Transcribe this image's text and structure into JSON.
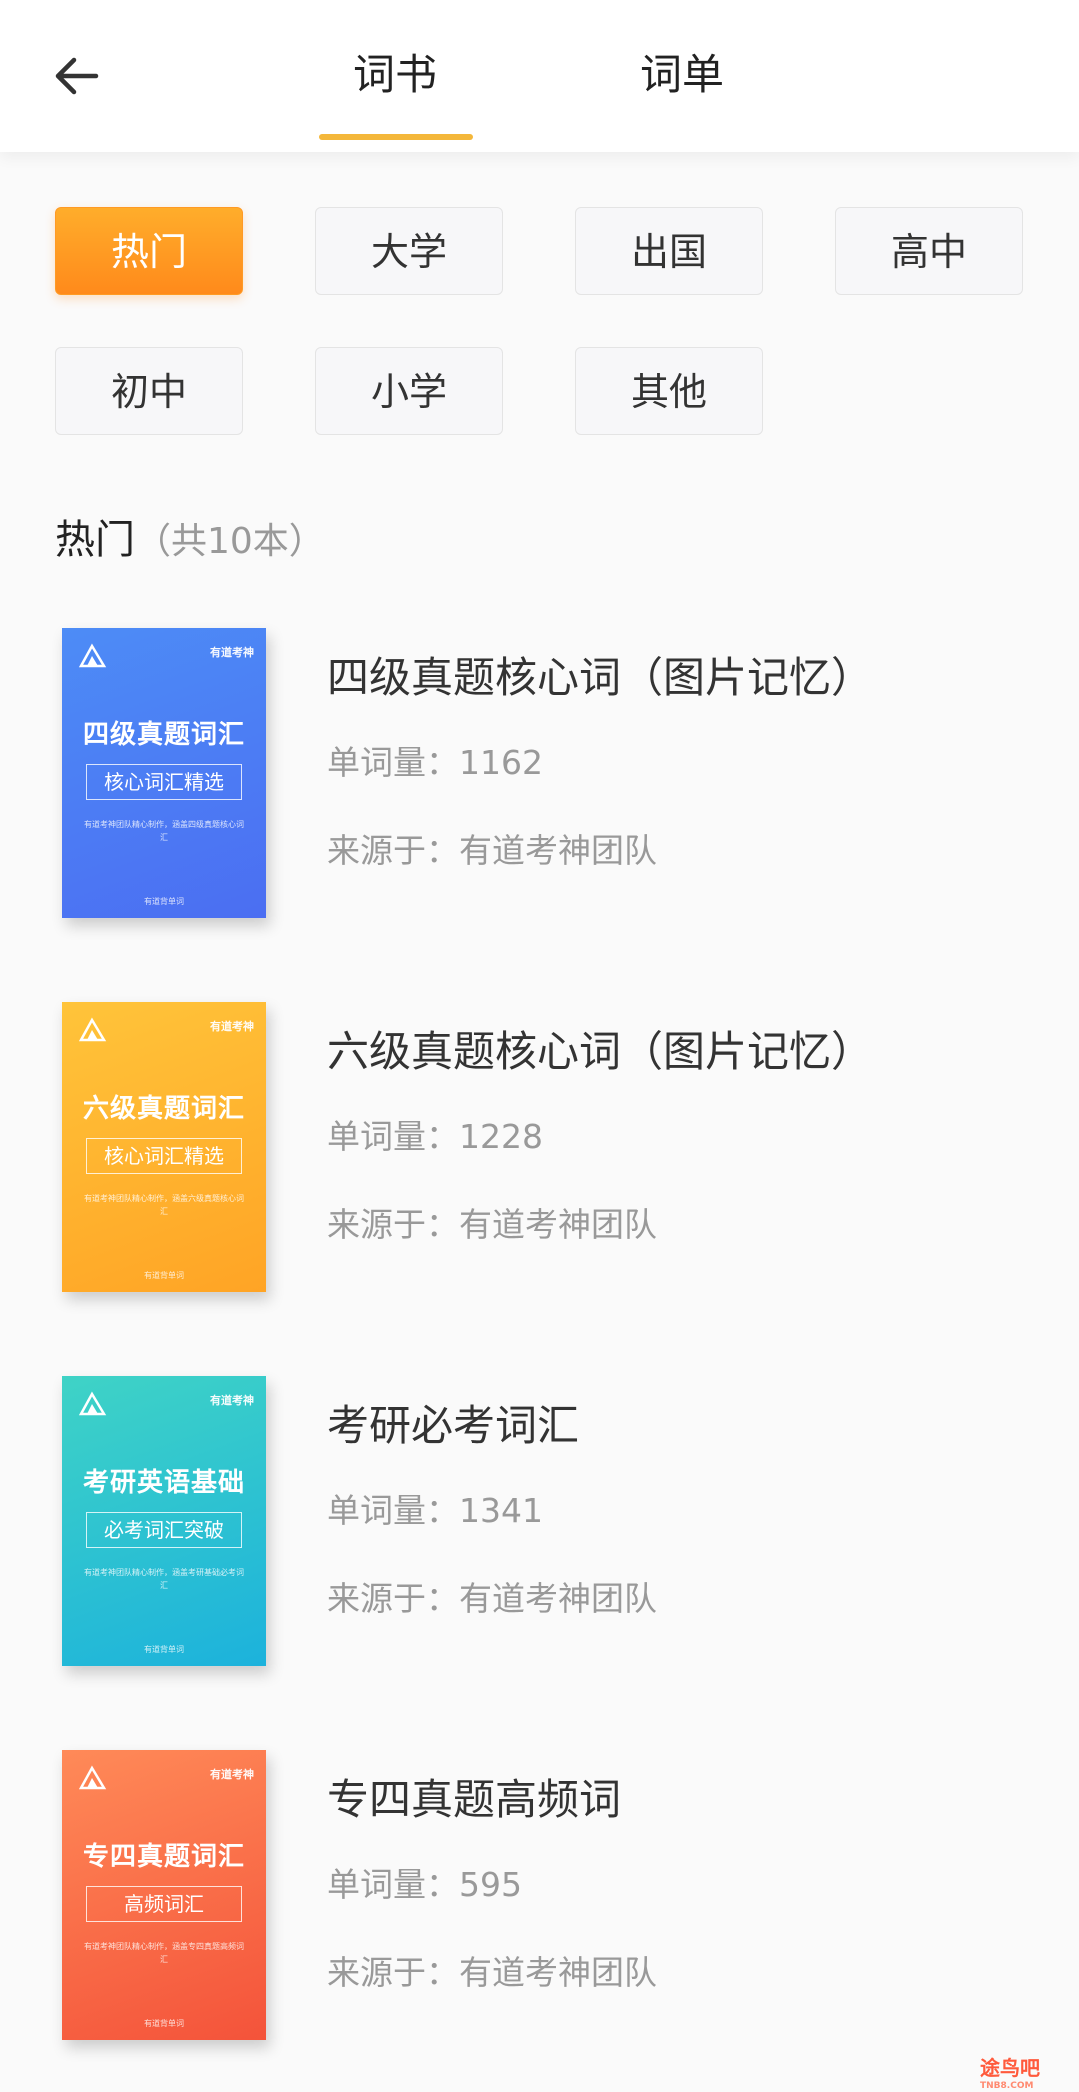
{
  "header": {
    "back_icon": "arrow-left-icon",
    "tabs": [
      {
        "label": "词书",
        "active": true
      },
      {
        "label": "词单",
        "active": false
      }
    ],
    "accent_color": "#f4b73a"
  },
  "categories": [
    {
      "label": "热门",
      "active": true
    },
    {
      "label": "大学",
      "active": false
    },
    {
      "label": "出国",
      "active": false
    },
    {
      "label": "高中",
      "active": false
    },
    {
      "label": "初中",
      "active": false
    },
    {
      "label": "小学",
      "active": false
    },
    {
      "label": "其他",
      "active": false
    }
  ],
  "section": {
    "title": "热门",
    "count": "（共10本）"
  },
  "books": [
    {
      "title": "四级真题核心词（图片记忆）",
      "word_count": "单词量：1162",
      "source": "来源于：有道考神团队",
      "cover": {
        "theme": "blue",
        "brand": "有道考神",
        "title": "四级真题词汇",
        "subtitle": "核心词汇精选",
        "desc": "有道考神团队精心制作，涵盖四级真题核心词汇",
        "footer": "有道背单词"
      }
    },
    {
      "title": "六级真题核心词（图片记忆）",
      "word_count": "单词量：1228",
      "source": "来源于：有道考神团队",
      "cover": {
        "theme": "orange",
        "brand": "有道考神",
        "title": "六级真题词汇",
        "subtitle": "核心词汇精选",
        "desc": "有道考神团队精心制作，涵盖六级真题核心词汇",
        "footer": "有道背单词"
      }
    },
    {
      "title": "考研必考词汇",
      "word_count": "单词量：1341",
      "source": "来源于：有道考神团队",
      "cover": {
        "theme": "teal",
        "brand": "有道考神",
        "title": "考研英语基础",
        "subtitle": "必考词汇突破",
        "desc": "有道考神团队精心制作，涵盖考研基础必考词汇",
        "footer": "有道背单词"
      }
    },
    {
      "title": "专四真题高频词",
      "word_count": "单词量：595",
      "source": "来源于：有道考神团队",
      "cover": {
        "theme": "red",
        "brand": "有道考神",
        "title": "专四真题词汇",
        "subtitle": "高频词汇",
        "desc": "有道考神团队精心制作，涵盖专四真题高频词汇",
        "footer": "有道背单词"
      }
    }
  ],
  "watermark": {
    "text": "途鸟吧",
    "sub": "TNB8.COM"
  }
}
